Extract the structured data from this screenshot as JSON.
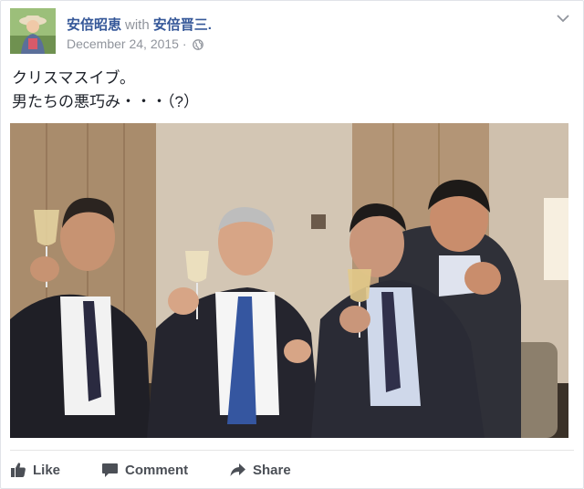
{
  "post": {
    "author": "安倍昭恵",
    "with_label": "with",
    "tagged": "安倍晋三.",
    "date": "December 24, 2015",
    "date_separator": "·",
    "privacy_icon": "globe-icon",
    "menu_icon": "chevron-down-icon",
    "text_lines": [
      "クリスマスイブ。",
      "男たちの悪巧み・・・（?）"
    ]
  },
  "actions": {
    "like_label": "Like",
    "like_icon": "thumbs-up-icon",
    "comment_label": "Comment",
    "comment_icon": "speech-bubble-icon",
    "share_label": "Share",
    "share_icon": "share-arrow-icon"
  },
  "colors": {
    "link": "#365899",
    "meta": "#90949c",
    "action": "#4b4f56",
    "text": "#1d2129"
  }
}
